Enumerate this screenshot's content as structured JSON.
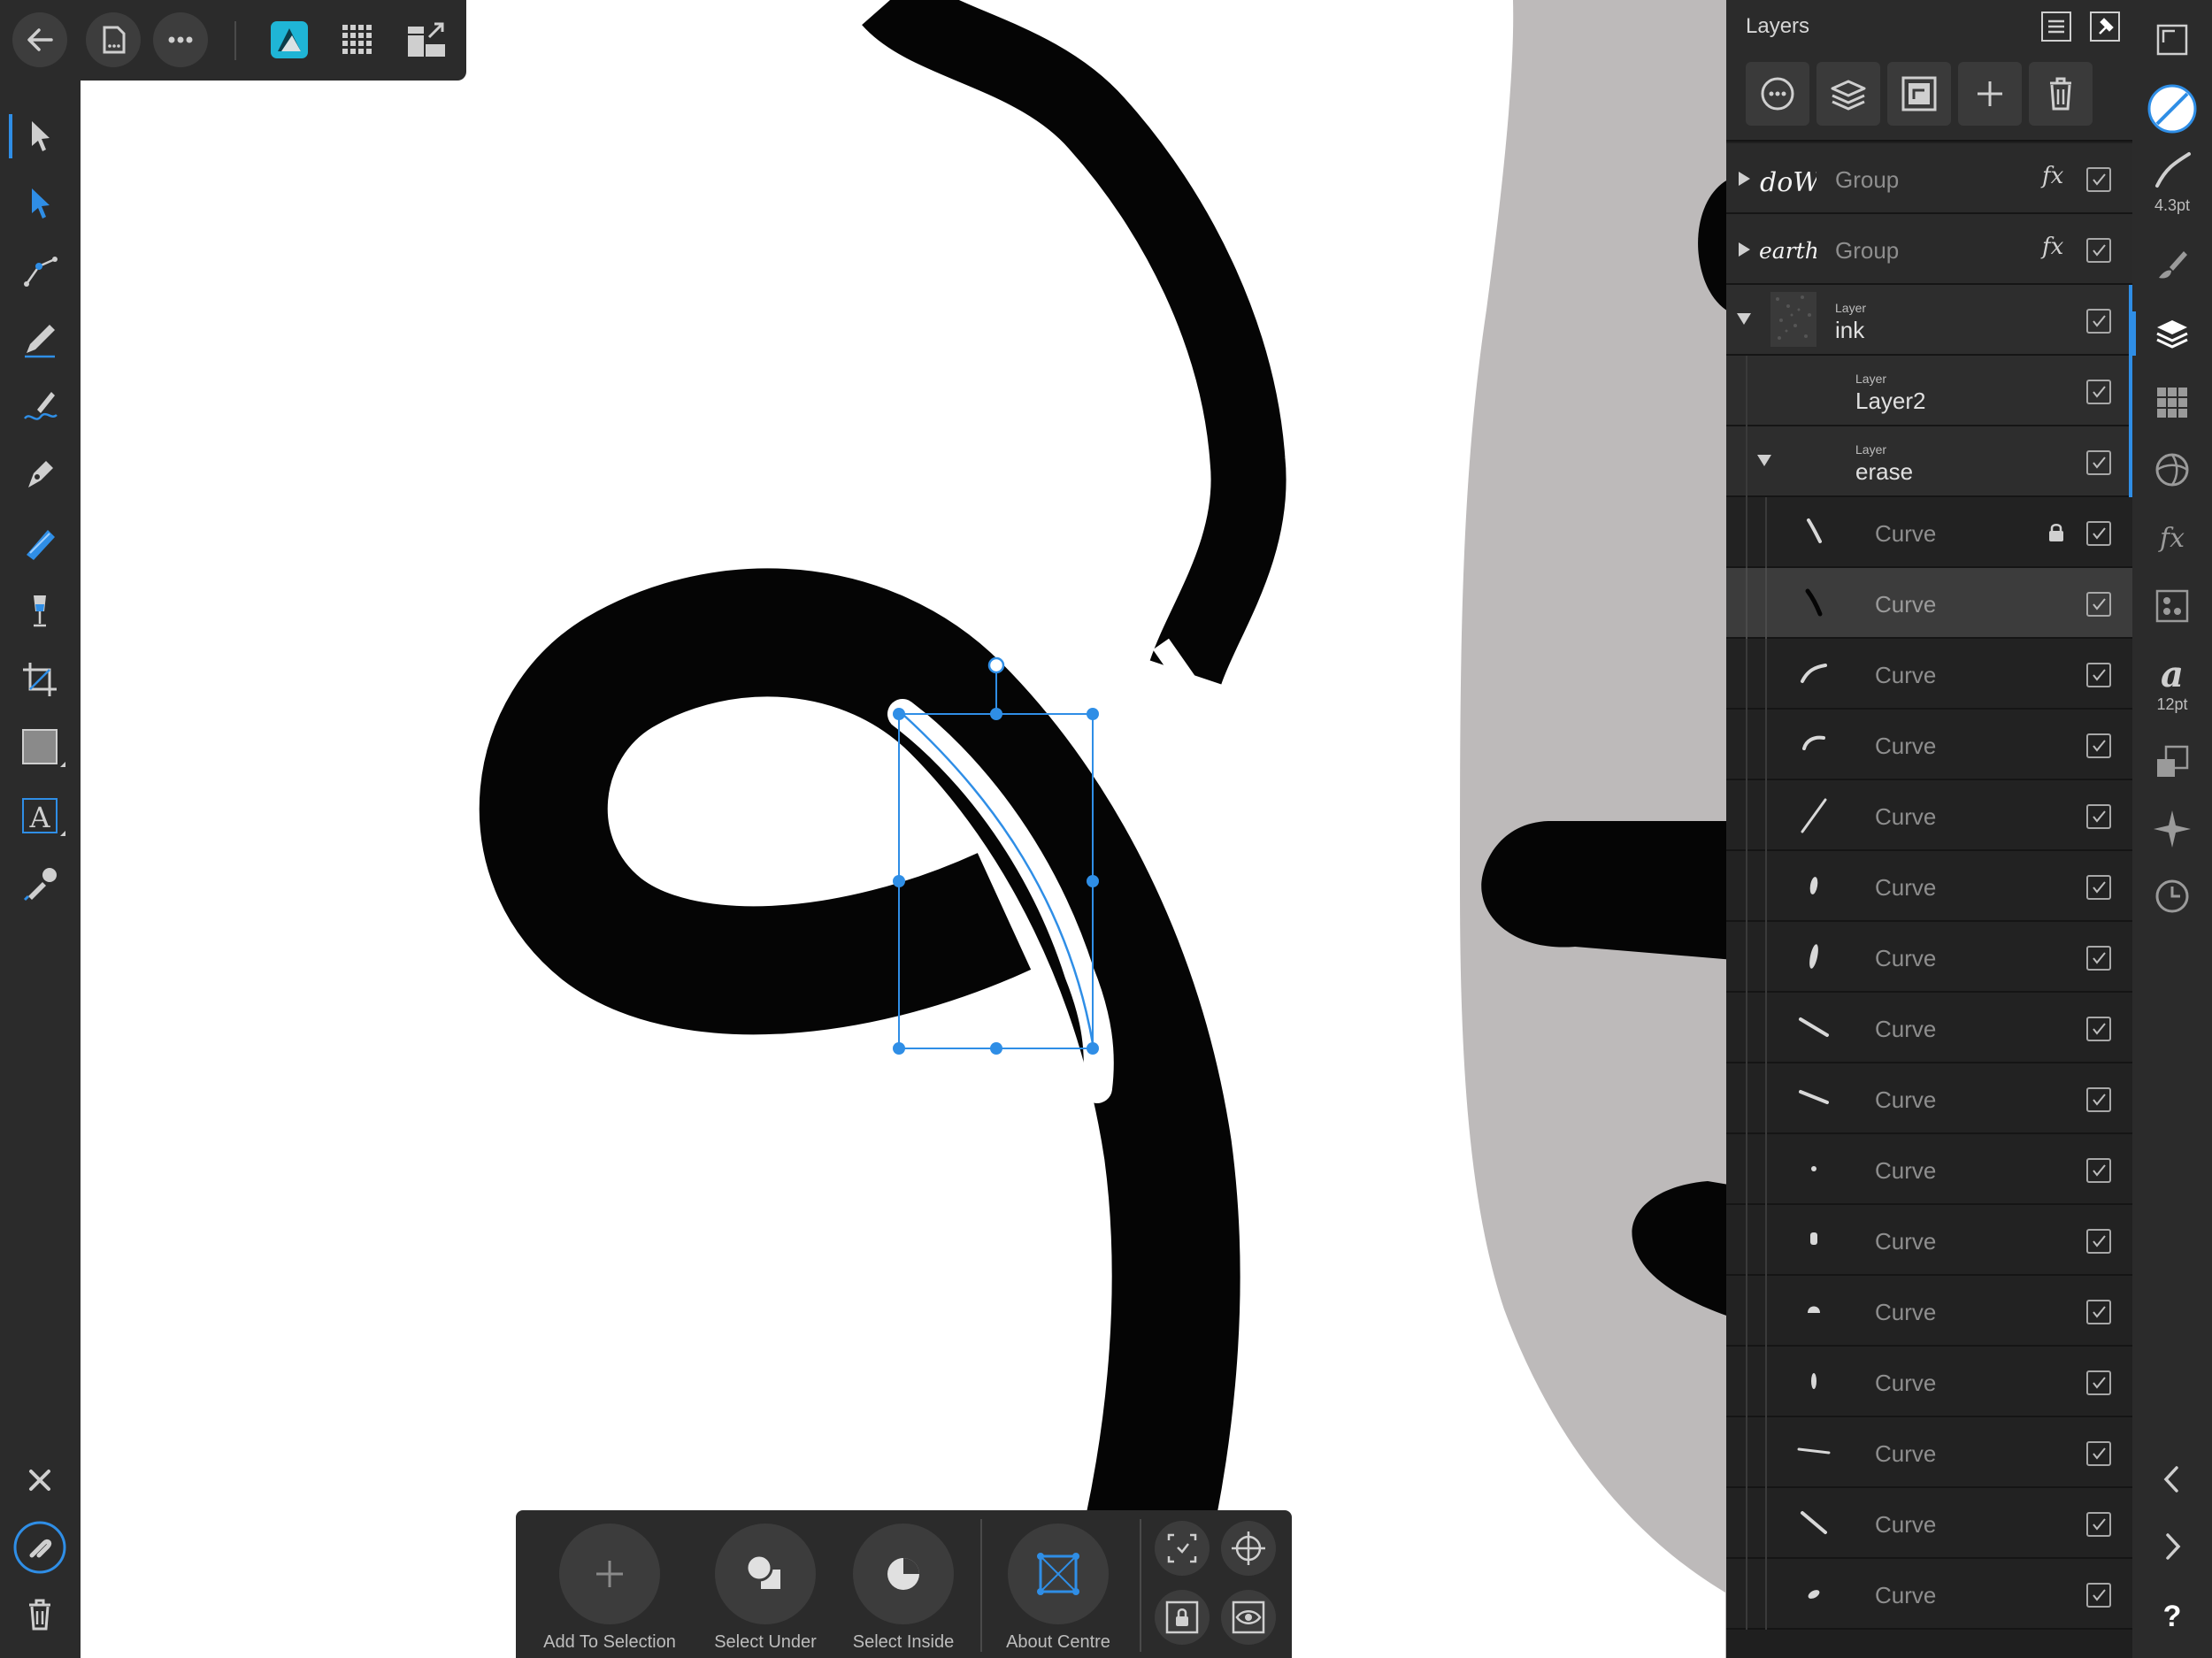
{
  "colors": {
    "accent": "#2f8ee6",
    "toolbar_bg": "#2b2b2b",
    "canvas_bg": "#ffffff",
    "grey_area": "#bdbaba",
    "ink": "#050505"
  },
  "top_toolbar": {
    "icons": [
      "back-arrow-icon",
      "document-icon",
      "more-icon",
      "affinity-designer-icon",
      "pixel-persona-icon",
      "export-persona-icon"
    ]
  },
  "right_bar": {
    "stroke_width_label": "4.3pt",
    "font_size_label": "12pt"
  },
  "layers_panel": {
    "title": "Layers",
    "rows": [
      {
        "kind": "group",
        "name": "Group",
        "thumb": "down-text-thumb",
        "fx": "fx",
        "expanded": false
      },
      {
        "kind": "group",
        "name": "Group",
        "thumb": "earth-text-thumb",
        "fx": "fx",
        "expanded": false
      },
      {
        "kind": "layer",
        "type": "Layer",
        "name": "ink",
        "expanded": true
      },
      {
        "kind": "layer",
        "type": "Layer",
        "name": "Layer2"
      },
      {
        "kind": "layer",
        "type": "Layer",
        "name": "erase",
        "expanded": true
      },
      {
        "kind": "curve",
        "name": "Curve",
        "locked": true
      },
      {
        "kind": "curve",
        "name": "Curve",
        "selected": true
      },
      {
        "kind": "curve",
        "name": "Curve"
      },
      {
        "kind": "curve",
        "name": "Curve"
      },
      {
        "kind": "curve",
        "name": "Curve"
      },
      {
        "kind": "curve",
        "name": "Curve"
      },
      {
        "kind": "curve",
        "name": "Curve"
      },
      {
        "kind": "curve",
        "name": "Curve"
      },
      {
        "kind": "curve",
        "name": "Curve"
      },
      {
        "kind": "curve",
        "name": "Curve"
      },
      {
        "kind": "curve",
        "name": "Curve"
      },
      {
        "kind": "curve",
        "name": "Curve"
      },
      {
        "kind": "curve",
        "name": "Curve"
      },
      {
        "kind": "curve",
        "name": "Curve"
      },
      {
        "kind": "curve",
        "name": "Curve"
      },
      {
        "kind": "curve",
        "name": "Curve"
      }
    ]
  },
  "context_toolbar": {
    "add_to_selection": "Add To Selection",
    "select_under": "Select Under",
    "select_inside": "Select Inside",
    "about_centre": "About Centre"
  }
}
